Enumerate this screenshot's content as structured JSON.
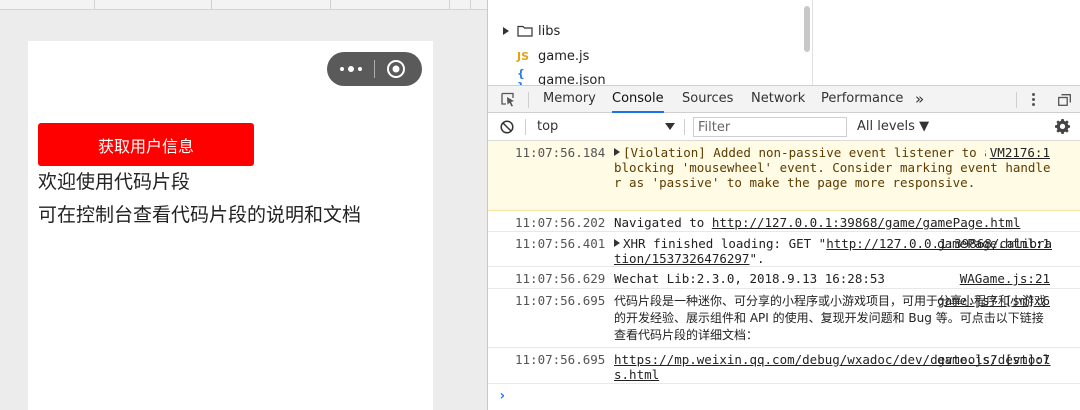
{
  "simulator": {
    "cta_label": "获取用户信息",
    "welcome_text": "欢迎使用代码片段",
    "hint_text": "可在控制台查看代码片段的说明和文档",
    "cta_color": "#ff0000"
  },
  "file_tree": {
    "items": [
      {
        "label": "libs",
        "icon": "folder-icon"
      },
      {
        "label": "game.js",
        "icon": "js-file-icon",
        "badge": "JS"
      },
      {
        "label": "game.json",
        "icon": "json-file-icon",
        "badge": "{ }"
      }
    ]
  },
  "devtools": {
    "tabs": [
      "Memory",
      "Console",
      "Sources",
      "Network",
      "Performance",
      "»"
    ],
    "active_tab": "Console",
    "context": "top",
    "filter_placeholder": "Filter",
    "levels_label": "All levels ▼",
    "accent_color": "#1a73e8"
  },
  "console": {
    "messages": [
      {
        "time": "11:07:56.184",
        "text": "[Violation] Added non-passive event listener to a scroll-blocking 'mousewheel' event. Consider marking event handler as 'passive' to make the page more responsive.",
        "source": "VM2176:1",
        "level": "warning"
      },
      {
        "time": "11:07:56.202",
        "prefix": "Navigated to ",
        "link": "http://127.0.0.1:39868/game/gamePage.html"
      },
      {
        "time": "11:07:56.401",
        "prefix": "XHR finished loading: GET \"",
        "link": "http://127.0.0.1:39868/calibration/1537326476297",
        "suffix": "\".",
        "source": "gamePage.html:1"
      },
      {
        "time": "11:07:56.629",
        "text": "Wechat Lib:2.3.0, 2018.9.13 16:28:53",
        "source": "WAGame.js:21"
      },
      {
        "time": "11:07:56.695",
        "text": "代码片段是一种迷你、可分享的小程序或小游戏项目，可用于分享小程序和小游戏的开发经验、展示组件和 API 的使用、复现开发问题和 Bug 等。可点击以下链接查看代码片段的详细文档：",
        "source": "game.js? [sm]:6"
      },
      {
        "time": "11:07:56.695",
        "link": "https://mp.weixin.qq.com/debug/wxadoc/dev/devtools/devtools.html",
        "source": "game.js? [sm]:7"
      }
    ],
    "prompt": "›"
  }
}
